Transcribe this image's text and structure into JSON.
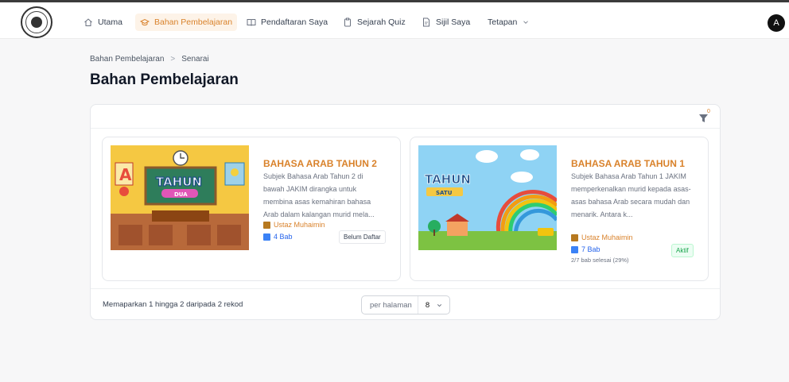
{
  "nav": {
    "items": [
      {
        "label": "Utama",
        "icon": "home-icon"
      },
      {
        "label": "Bahan Pembelajaran",
        "icon": "graduation-cap-icon",
        "active": true
      },
      {
        "label": "Pendaftaran Saya",
        "icon": "book-open-icon"
      },
      {
        "label": "Sejarah Quiz",
        "icon": "clipboard-icon"
      },
      {
        "label": "Sijil Saya",
        "icon": "document-icon"
      },
      {
        "label": "Tetapan",
        "icon": "chevron-down-icon"
      }
    ],
    "avatar_initial": "A",
    "accent": "#d9822b"
  },
  "breadcrumb": {
    "root": "Bahan Pembelajaran",
    "separator": ">",
    "current": "Senarai"
  },
  "page_title": "Bahan Pembelajaran",
  "filter": {
    "count": "0"
  },
  "courses": [
    {
      "title": "BAHASA ARAB TAHUN 2",
      "description": "Subjek Bahasa Arab Tahun 2 di bawah JAKIM dirangka untuk membina asas kemahiran bahasa Arab dalam kalangan murid mela...",
      "teacher": "Ustaz Muhaimin",
      "chapters": "4 Bab",
      "status": "Belum Daftar",
      "progress": "",
      "thumb_word": "TAHUN",
      "thumb_sub": "DUA"
    },
    {
      "title": "BAHASA ARAB TAHUN 1",
      "description": "Subjek Bahasa Arab Tahun 1 JAKIM memperkenalkan murid kepada asas-asas bahasa Arab secara mudah dan menarik. Antara k...",
      "teacher": "Ustaz Muhaimin",
      "chapters": "7 Bab",
      "status": "Aktif",
      "progress": "2/7 bab selesai (29%)",
      "thumb_word": "TAHUN",
      "thumb_sub": "SATU"
    }
  ],
  "footer": {
    "showing": "Memaparkan 1 hingga 2 daripada 2 rekod",
    "per_page_label": "per halaman",
    "per_page_value": "8"
  }
}
